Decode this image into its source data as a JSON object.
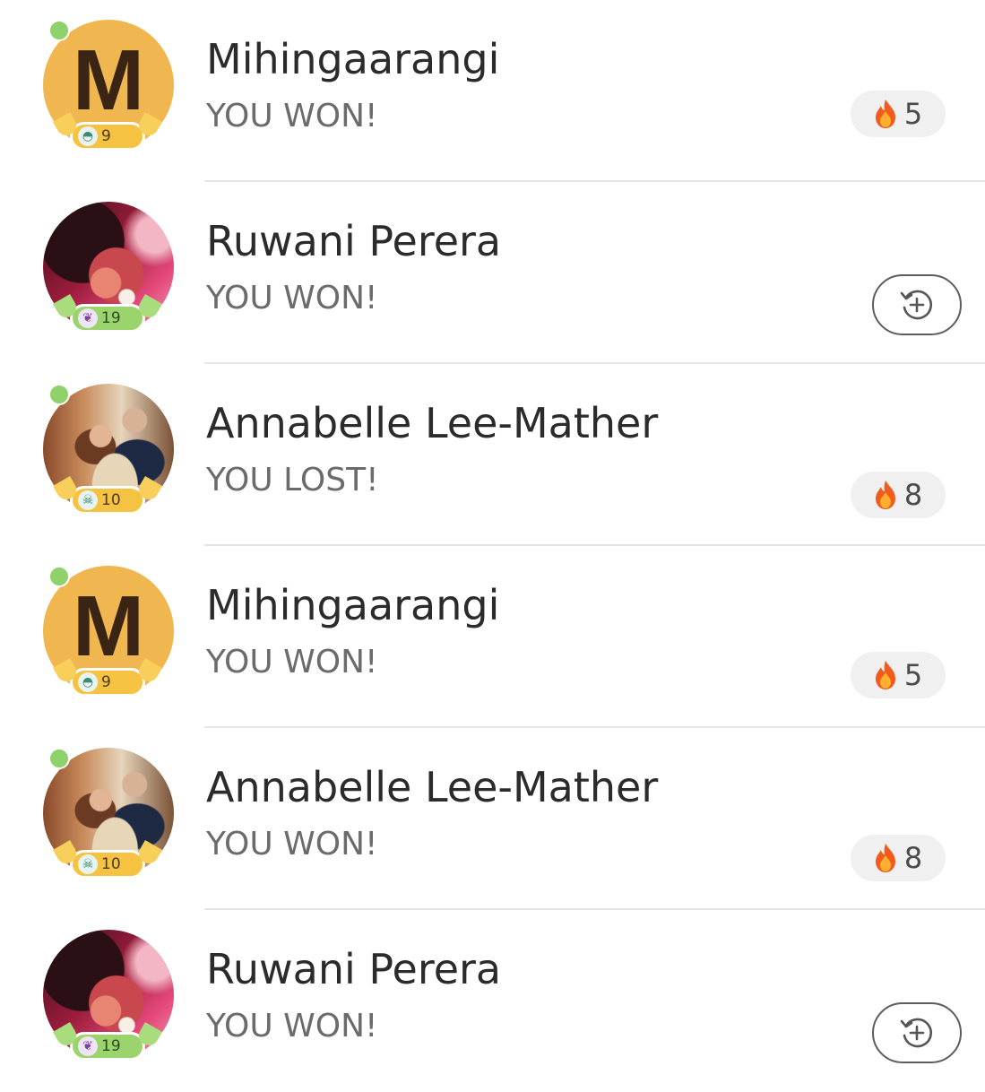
{
  "matches": [
    {
      "name": "Mihingaarangi",
      "result": "YOU WON!",
      "avatar": {
        "kind": "letter",
        "letter": "M"
      },
      "online": true,
      "level": {
        "value": "9",
        "league_icon": "turtle-shell-icon",
        "badge_color": "#f5c341"
      },
      "action": {
        "type": "streak",
        "icon": "fire-icon",
        "count": "5"
      }
    },
    {
      "name": "Ruwani Perera",
      "result": "YOU WON!",
      "avatar": {
        "kind": "photo",
        "photo": "ruwani"
      },
      "online": false,
      "level": {
        "value": "19",
        "league_icon": "purple-wings-icon",
        "badge_color": "#9bd46d"
      },
      "action": {
        "type": "rematch",
        "icon": "rematch-icon"
      }
    },
    {
      "name": "Annabelle Lee-Mather",
      "result": "YOU LOST!",
      "avatar": {
        "kind": "photo",
        "photo": "annabelle"
      },
      "online": true,
      "level": {
        "value": "10",
        "league_icon": "skull-icon",
        "badge_color": "#f5c341"
      },
      "action": {
        "type": "streak",
        "icon": "fire-icon",
        "count": "8"
      }
    },
    {
      "name": "Mihingaarangi",
      "result": "YOU WON!",
      "avatar": {
        "kind": "letter",
        "letter": "M"
      },
      "online": true,
      "level": {
        "value": "9",
        "league_icon": "turtle-shell-icon",
        "badge_color": "#f5c341"
      },
      "action": {
        "type": "streak",
        "icon": "fire-icon",
        "count": "5"
      }
    },
    {
      "name": "Annabelle Lee-Mather",
      "result": "YOU WON!",
      "avatar": {
        "kind": "photo",
        "photo": "annabelle"
      },
      "online": true,
      "level": {
        "value": "10",
        "league_icon": "skull-icon",
        "badge_color": "#f5c341"
      },
      "action": {
        "type": "streak",
        "icon": "fire-icon",
        "count": "8"
      }
    },
    {
      "name": "Ruwani Perera",
      "result": "YOU WON!",
      "avatar": {
        "kind": "photo",
        "photo": "ruwani"
      },
      "online": false,
      "level": {
        "value": "19",
        "league_icon": "purple-wings-icon",
        "badge_color": "#9bd46d"
      },
      "action": {
        "type": "rematch",
        "icon": "rematch-icon"
      }
    }
  ],
  "colors": {
    "online_dot": "#8fd16a",
    "divider": "#e5e5e5",
    "streak_pill": "#f0f0f0",
    "letter_avatar_bg": "#f0b64f"
  }
}
